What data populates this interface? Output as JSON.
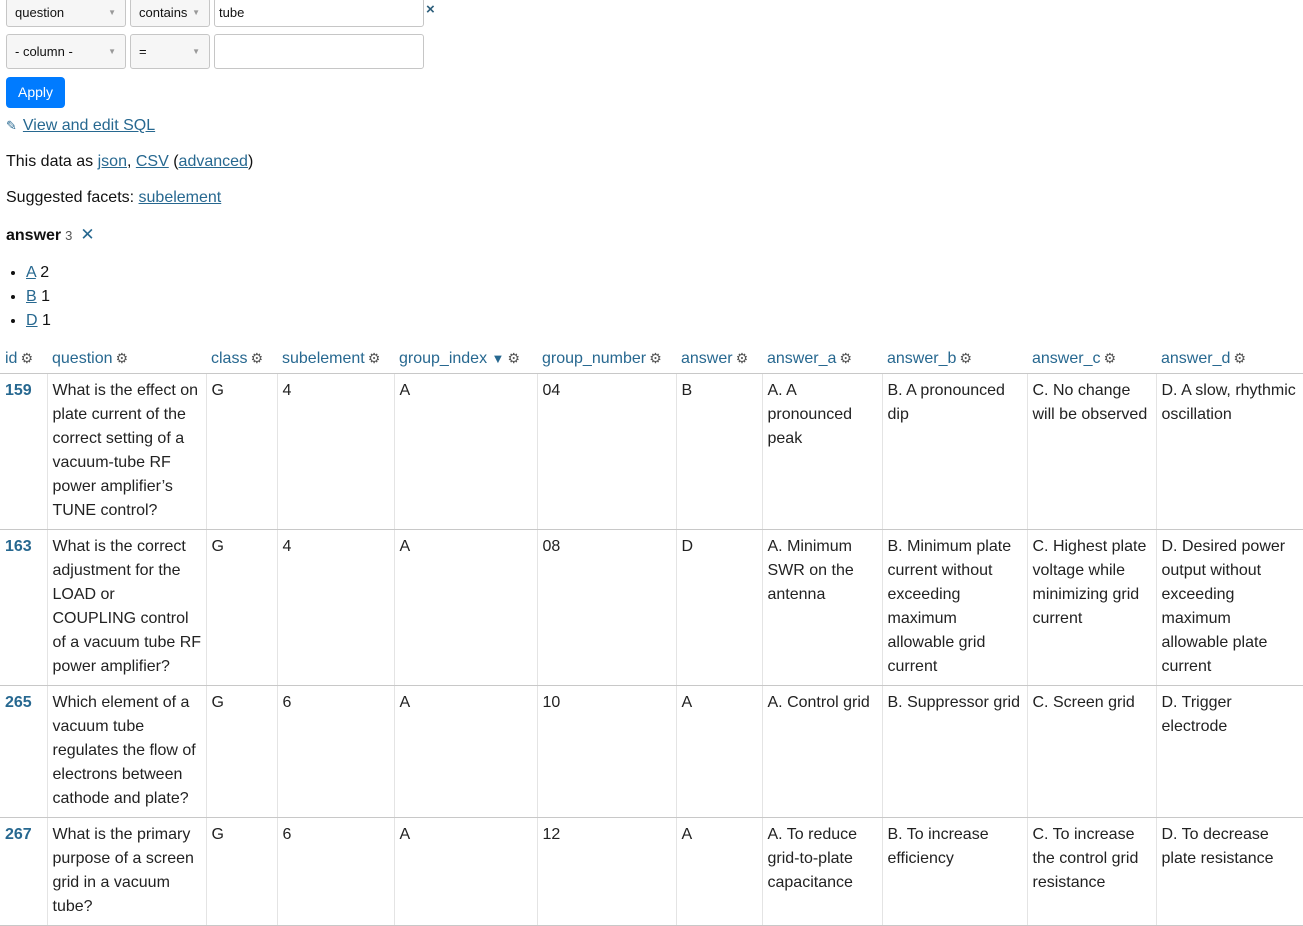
{
  "filters": [
    {
      "column": "question",
      "op": "contains",
      "value": "tube",
      "remove_icon": "×"
    },
    {
      "column": "- column -",
      "op": "=",
      "value": ""
    }
  ],
  "apply_label": "Apply",
  "sql_link": "View and edit SQL",
  "data_as": {
    "prefix": "This data as ",
    "json": "json",
    "csv": "CSV",
    "advanced": "advanced"
  },
  "suggested_facets": {
    "prefix": "Suggested facets: ",
    "link": "subelement"
  },
  "facet": {
    "name": "answer",
    "count": "3",
    "items": [
      {
        "label": "A",
        "count": "2"
      },
      {
        "label": "B",
        "count": "1"
      },
      {
        "label": "D",
        "count": "1"
      }
    ]
  },
  "table": {
    "columns": [
      "id",
      "question",
      "class",
      "subelement",
      "group_index",
      "group_number",
      "answer",
      "answer_a",
      "answer_b",
      "answer_c",
      "answer_d"
    ],
    "sorted_column": "group_index",
    "rows": [
      [
        "159",
        "What is the effect on plate current of the correct setting of a vacuum-tube RF power amplifier’s TUNE control?",
        "G",
        "4",
        "A",
        "04",
        "B",
        "A. A pronounced peak",
        "B. A pronounced dip",
        "C. No change will be observed",
        "D. A slow, rhythmic oscillation"
      ],
      [
        "163",
        "What is the correct adjustment for the LOAD or COUPLING control of a vacuum tube RF power amplifier?",
        "G",
        "4",
        "A",
        "08",
        "D",
        "A. Minimum SWR on the antenna",
        "B. Minimum plate current without exceeding maximum allowable grid current",
        "C. Highest plate voltage while minimizing grid current",
        "D. Desired power output without exceeding maximum allowable plate current"
      ],
      [
        "265",
        "Which element of a vacuum tube regulates the flow of electrons between cathode and plate?",
        "G",
        "6",
        "A",
        "10",
        "A",
        "A. Control grid",
        "B. Suppressor grid",
        "C. Screen grid",
        "D. Trigger electrode"
      ],
      [
        "267",
        "What is the primary purpose of a screen grid in a vacuum tube?",
        "G",
        "6",
        "A",
        "12",
        "A",
        "A. To reduce grid-to-plate capacitance",
        "B. To increase efficiency",
        "C. To increase the control grid resistance",
        "D. To decrease plate resistance"
      ]
    ]
  }
}
